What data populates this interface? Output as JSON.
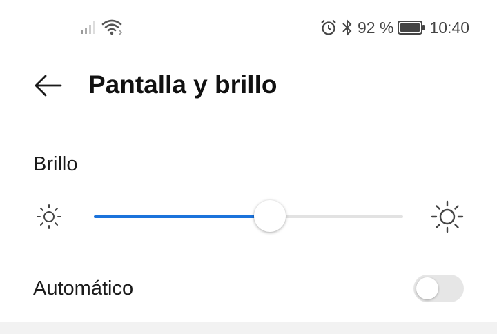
{
  "status_bar": {
    "battery_percent": "92 %",
    "time": "10:40",
    "icons": [
      "signal-icon",
      "wifi-icon",
      "alarm-icon",
      "bluetooth-icon",
      "battery-icon"
    ]
  },
  "header": {
    "title": "Pantalla y brillo",
    "back_icon": "back-arrow-icon"
  },
  "brightness": {
    "label": "Brillo",
    "level": 0.57,
    "accent_color": "#1b73db",
    "icons": [
      "sun-small-icon",
      "sun-large-icon"
    ]
  },
  "automatic": {
    "label": "Automático",
    "enabled": false
  }
}
